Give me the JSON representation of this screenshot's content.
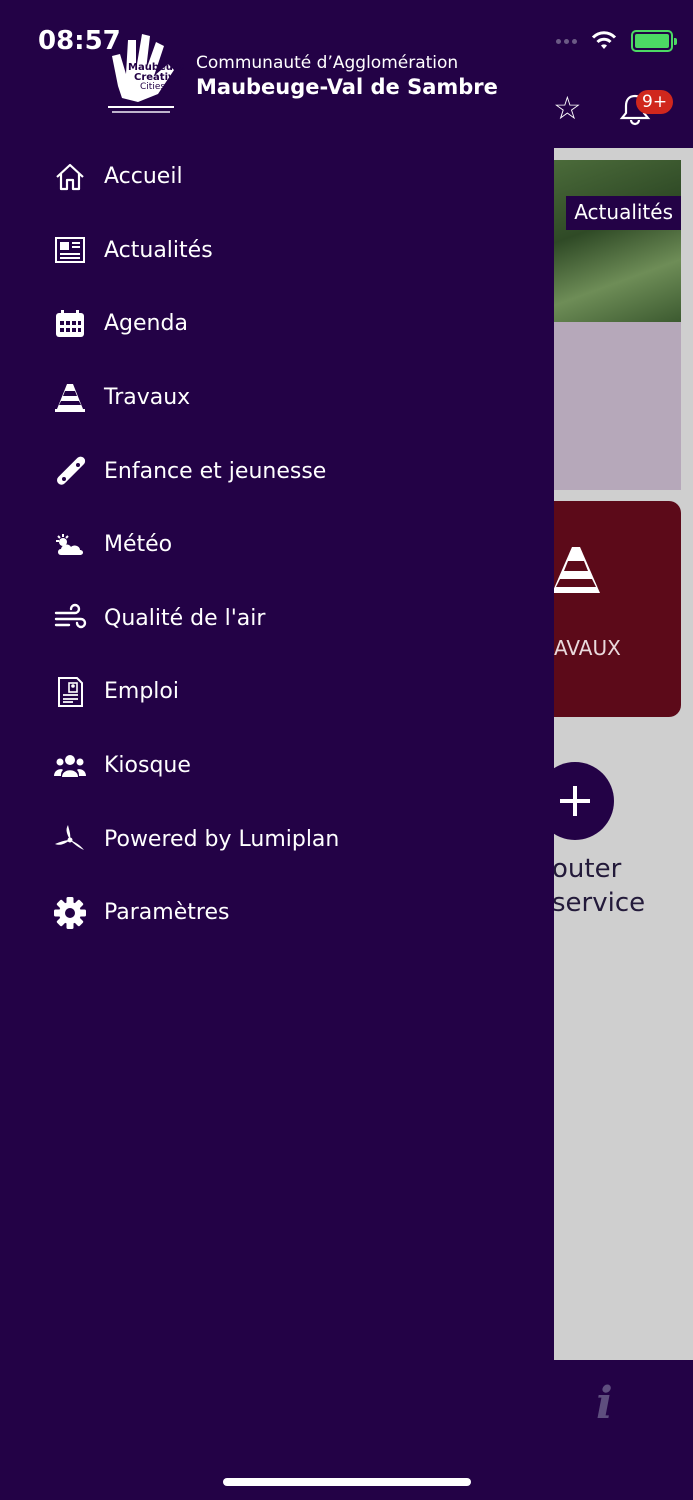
{
  "status_bar": {
    "time": "08:57"
  },
  "brand": {
    "line1": "Communauté d’Agglomération",
    "line2": "Maubeuge-Val de Sambre",
    "logo_text": "Maubeuge Creative Cities"
  },
  "menu": [
    {
      "label": "Accueil",
      "icon": "home-icon"
    },
    {
      "label": "Actualités",
      "icon": "newspaper-icon"
    },
    {
      "label": "Agenda",
      "icon": "calendar-icon"
    },
    {
      "label": "Travaux",
      "icon": "traffic-cone-icon"
    },
    {
      "label": "Enfance et jeunesse",
      "icon": "skateboard-icon"
    },
    {
      "label": "Météo",
      "icon": "weather-icon"
    },
    {
      "label": "Qualité de l'air",
      "icon": "wind-icon"
    },
    {
      "label": "Emploi",
      "icon": "resume-icon"
    },
    {
      "label": "Kiosque",
      "icon": "users-icon"
    },
    {
      "label": "Powered by Lumiplan",
      "icon": "lumiplan-icon"
    },
    {
      "label": "Paramètres",
      "icon": "gear-icon"
    }
  ],
  "background": {
    "notification_badge": "9+",
    "news_tag": "Actualités",
    "travaux_label": "AVAUX",
    "add_service_label": "outer\nservice"
  },
  "colors": {
    "drawer": "#230246",
    "travaux_card": "#5c0a19",
    "badge": "#d0271d",
    "battery": "#4cd964"
  }
}
